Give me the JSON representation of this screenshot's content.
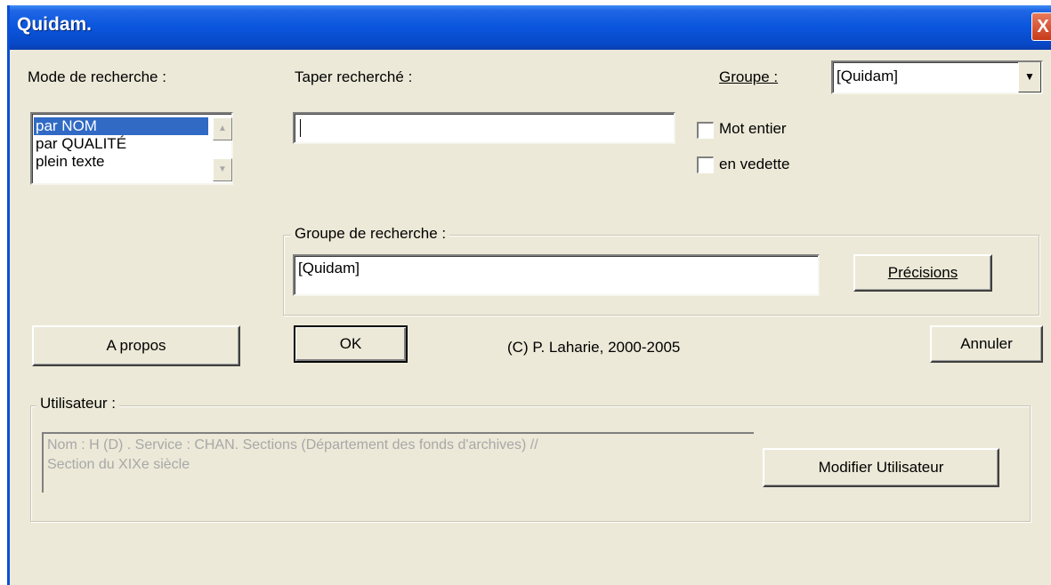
{
  "window": {
    "title": "Quidam.",
    "close_glyph": "X"
  },
  "mode": {
    "label": "Mode de recherche :",
    "items": [
      "par NOM",
      "par QUALITÉ",
      "plein texte"
    ],
    "selected_index": 0
  },
  "search": {
    "label": "Taper  recherché :",
    "value": ""
  },
  "groupe": {
    "label": "Groupe :",
    "value": "[Quidam]"
  },
  "options": {
    "mot_entier": "Mot entier",
    "en_vedette": "en vedette"
  },
  "groupe_recherche": {
    "legend": "Groupe de recherche :",
    "value": "[Quidam]",
    "precisions_button": "Précisions"
  },
  "buttons": {
    "a_propos": "A propos",
    "ok": "OK",
    "annuler": "Annuler"
  },
  "copyright": "(C) P. Laharie, 2000-2005",
  "utilisateur": {
    "legend": "Utilisateur :",
    "info_line1": "Nom : H (D) . Service : CHAN. Sections (Département des fonds d'archives) //",
    "info_line2": "Section du XIXe siècle",
    "modify_button": "Modifier Utilisateur"
  }
}
